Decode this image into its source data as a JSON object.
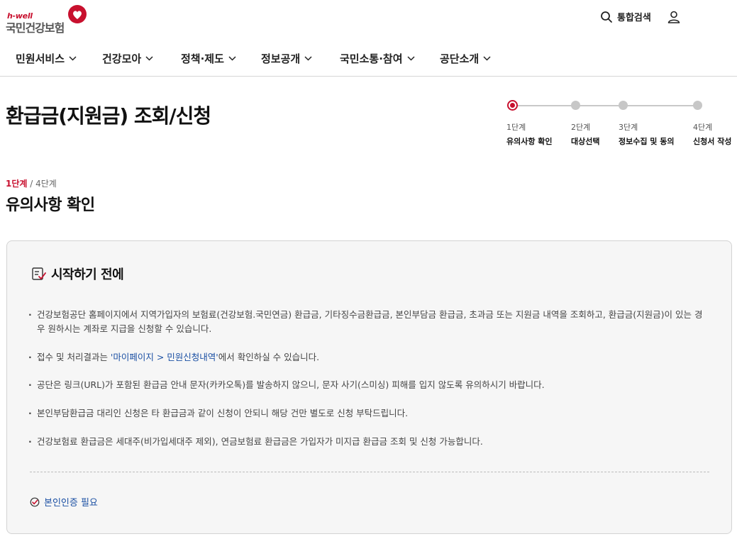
{
  "header": {
    "logo_sub": "h-well",
    "logo_main": "국민건강보험",
    "search_label": "통합검색"
  },
  "gnb": [
    {
      "label": "민원서비스"
    },
    {
      "label": "건강모아"
    },
    {
      "label": "정책·제도"
    },
    {
      "label": "정보공개"
    },
    {
      "label": "국민소통·참여"
    },
    {
      "label": "공단소개"
    }
  ],
  "page": {
    "title": "환급금(지원금) 조회/신청"
  },
  "stepper": {
    "steps": [
      {
        "num": "1단계",
        "name": "유의사항 확인",
        "active": true
      },
      {
        "num": "2단계",
        "name": "대상선택",
        "active": false
      },
      {
        "num": "3단계",
        "name": "정보수집 및 동의",
        "active": false
      },
      {
        "num": "4단계",
        "name": "신청서 작성",
        "active": false
      }
    ]
  },
  "section": {
    "current_step": "1단계",
    "total_step": " / 4단계",
    "title": "유의사항 확인"
  },
  "info_box": {
    "title": "시작하기 전에",
    "notices": [
      {
        "text": "건강보험공단 홈페이지에서 지역가입자의 보험료(건강보험.국민연금) 환급금, 기타징수금환급금, 본인부담금 환급금, 초과금 또는 지원금 내역을 조회하고, 환급금(지원금)이 있는 경우 원하시는 계좌로 지급을 신청할 수 있습니다."
      },
      {
        "before": "접수 및 처리결과는 ",
        "link": "'마이페이지 > 민원신청내역'",
        "after": "에서 확인하실 수 있습니다."
      },
      {
        "text": "공단은 링크(URL)가 포함된 환급금 안내 문자(카카오톡)를 발송하지 않으니, 문자 사기(스미싱) 피해를 입지 않도록 유의하시기 바랍니다."
      },
      {
        "text": "본인부담환급금 대리인 신청은 타 환급금과 같이 신청이 안되니 해당 건만 별도로 신청 부탁드립니다."
      },
      {
        "text": "건강보험료 환급금은 세대주(비가입세대주 제외), 연금보험료 환급금은 가입자가 미지급 환급금 조회 및 신청 가능합니다."
      }
    ],
    "auth_label": "본인인증 필요"
  },
  "colors": {
    "brand_red": "#c8102e",
    "link_blue": "#1a4fa3"
  },
  "icons": [
    "heart-logo-icon",
    "search-icon",
    "user-icon",
    "chevron-down-icon",
    "checklist-icon",
    "check-circle-icon"
  ]
}
